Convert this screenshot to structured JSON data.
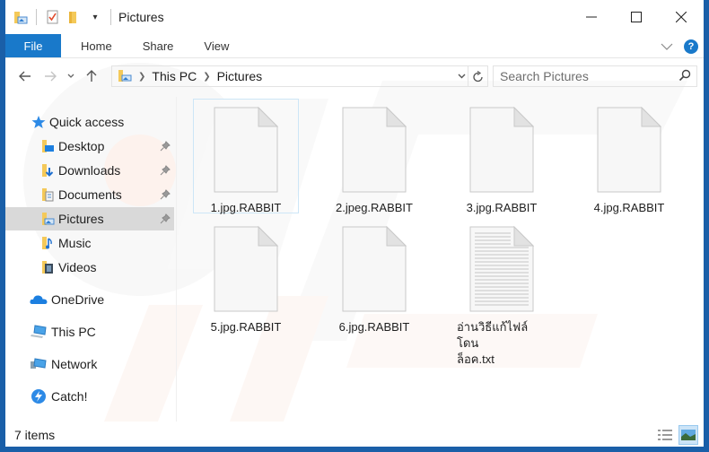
{
  "window": {
    "title": "Pictures",
    "controls": {
      "minimize": "–",
      "maximize": "☐",
      "close": "✕"
    }
  },
  "ribbon": {
    "file_label": "File",
    "tabs": [
      "Home",
      "Share",
      "View"
    ],
    "help_label": "?"
  },
  "navigation": {
    "back": "←",
    "forward": "→",
    "recent": "⌄",
    "up": "↑",
    "breadcrumb": [
      "This PC",
      "Pictures"
    ],
    "search_placeholder": "Search Pictures"
  },
  "sidebar": {
    "quick_access": "Quick access",
    "pinned": [
      {
        "label": "Desktop",
        "icon": "desktop-folder-icon"
      },
      {
        "label": "Downloads",
        "icon": "downloads-folder-icon"
      },
      {
        "label": "Documents",
        "icon": "documents-folder-icon"
      },
      {
        "label": "Pictures",
        "icon": "pictures-folder-icon",
        "selected": true
      },
      {
        "label": "Music",
        "icon": "music-folder-icon"
      },
      {
        "label": "Videos",
        "icon": "videos-folder-icon"
      }
    ],
    "locations": [
      {
        "label": "OneDrive",
        "icon": "onedrive-icon"
      },
      {
        "label": "This PC",
        "icon": "this-pc-icon"
      },
      {
        "label": "Network",
        "icon": "network-icon"
      },
      {
        "label": "Catch!",
        "icon": "catch-icon"
      }
    ]
  },
  "files": [
    {
      "name": "1.jpg.RABBIT",
      "type": "blank"
    },
    {
      "name": "2.jpeg.RABBIT",
      "type": "blank"
    },
    {
      "name": "3.jpg.RABBIT",
      "type": "blank"
    },
    {
      "name": "4.jpg.RABBIT",
      "type": "blank"
    },
    {
      "name": "5.jpg.RABBIT",
      "type": "blank"
    },
    {
      "name": "6.jpg.RABBIT",
      "type": "blank"
    },
    {
      "name": "อ่านวิธีแก้ไฟล์โดนล็อค.txt",
      "name_line1": "อ่านวิธีแก้ไฟล์โดน",
      "name_line2": "ล็อค.txt",
      "type": "text"
    }
  ],
  "status": {
    "item_count": "7 items"
  },
  "colors": {
    "accent": "#1979ca",
    "frame": "#1a5fa8",
    "selected_bg": "#d9d9d9"
  }
}
